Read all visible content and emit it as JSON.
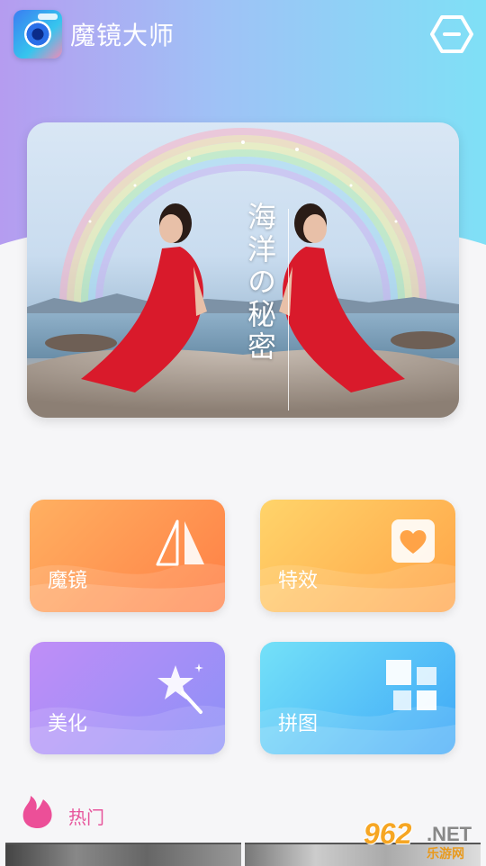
{
  "header": {
    "title": "魔镜大师"
  },
  "banner": {
    "text": "海洋の秘密"
  },
  "features": [
    {
      "label": "魔镜"
    },
    {
      "label": "特效"
    },
    {
      "label": "美化"
    },
    {
      "label": "拼图"
    }
  ],
  "hot": {
    "label": "热门"
  },
  "watermark": {
    "number": "962",
    "suffix": ".NET",
    "cn": "乐游网"
  },
  "colors": {
    "accent_pink": "#e7559c",
    "magic_card": "#ff8a4a",
    "effect_card": "#ffb150",
    "beauty_card": "#a38ff7",
    "collage_card": "#4fb8f7"
  }
}
